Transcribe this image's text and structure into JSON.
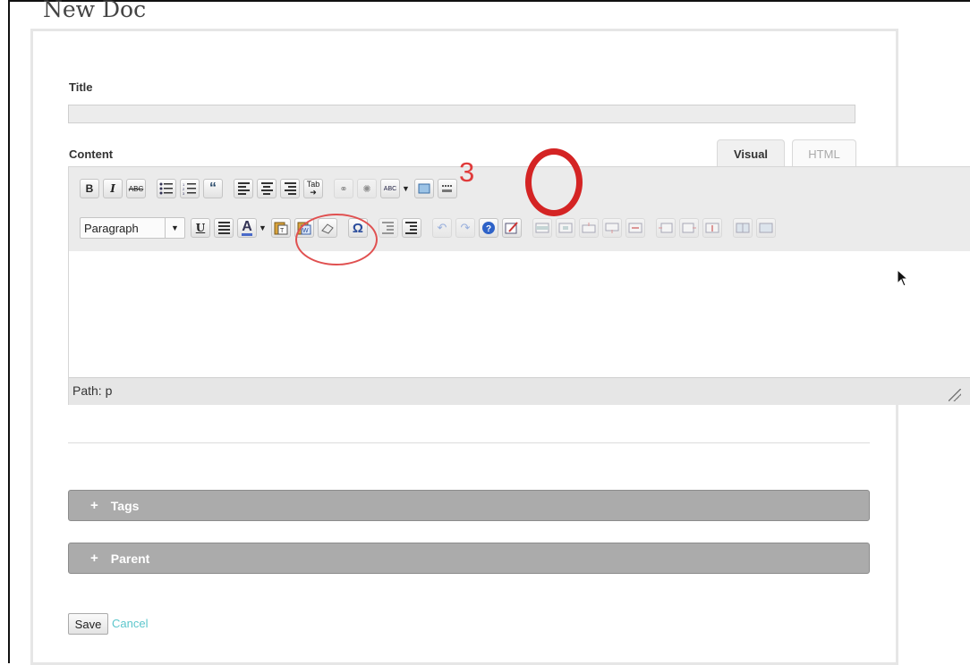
{
  "page": {
    "title": "New Doc"
  },
  "form": {
    "title_label": "Title",
    "title_value": "",
    "content_label": "Content"
  },
  "editor": {
    "tabs": [
      {
        "label": "Visual",
        "active": true
      },
      {
        "label": "HTML",
        "active": false
      }
    ],
    "toolbar_row1": {
      "bold": "B",
      "italic": "I",
      "strikethrough": "ABC",
      "blockquote": "“",
      "tab_key": "Tab",
      "spellcheck": "ABC"
    },
    "toolbar_row2": {
      "format_select_value": "Paragraph",
      "underline": "U",
      "text_color": "A",
      "special_char": "Ω"
    },
    "path_text": "Path: p"
  },
  "panels": [
    {
      "label": "Tags",
      "icon": "+"
    },
    {
      "label": "Parent",
      "icon": "+"
    }
  ],
  "actions": {
    "save_label": "Save",
    "cancel_label": "Cancel"
  },
  "annotations": {
    "step_label": "3",
    "color": "#d42424"
  },
  "colors": {
    "accent_link": "#5cc6cc",
    "panel_header_bg": "#ababab",
    "toolbar_bg": "#ebebeb"
  }
}
